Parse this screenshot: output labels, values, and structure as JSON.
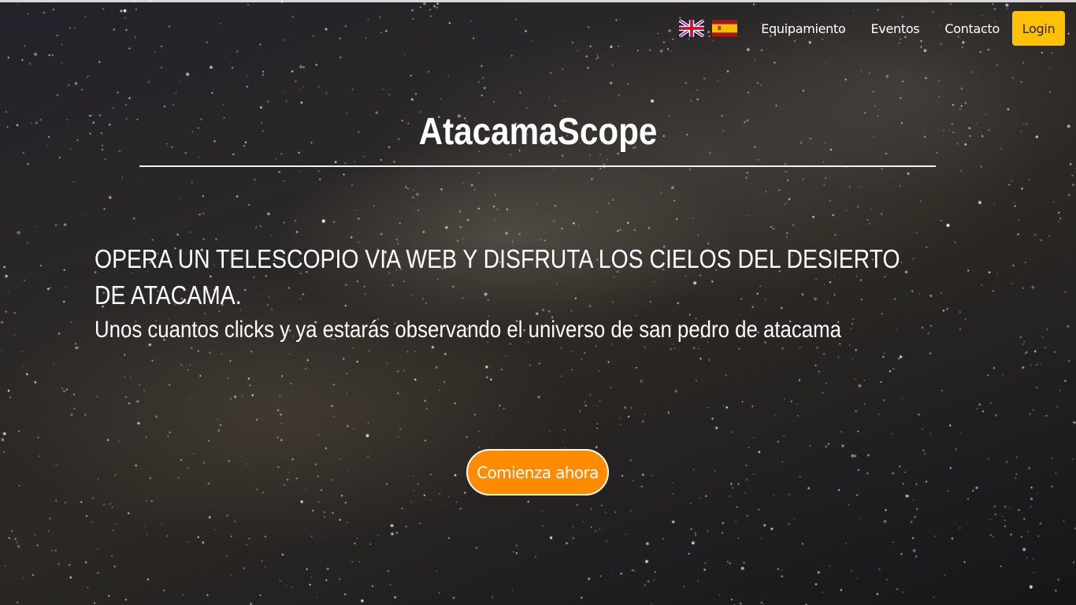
{
  "nav": {
    "flags": [
      {
        "name": "uk-flag-icon"
      },
      {
        "name": "spain-flag-icon"
      }
    ],
    "links": [
      "Equipamiento",
      "Eventos",
      "Contacto"
    ],
    "login_label": "Login"
  },
  "hero": {
    "title": "AtacamaScope",
    "headline": "OPERA UN TELESCOPIO VIA WEB Y DISFRUTA LOS CIELOS DEL DESIERTO DE ATACAMA.",
    "subheadline": "Unos cuantos clicks y ya estarás observando el universo de san pedro de atacama",
    "cta_label": "Comienza ahora"
  },
  "colors": {
    "login": "#ffc107",
    "cta": "#ff8c00",
    "text": "#ffffff"
  }
}
